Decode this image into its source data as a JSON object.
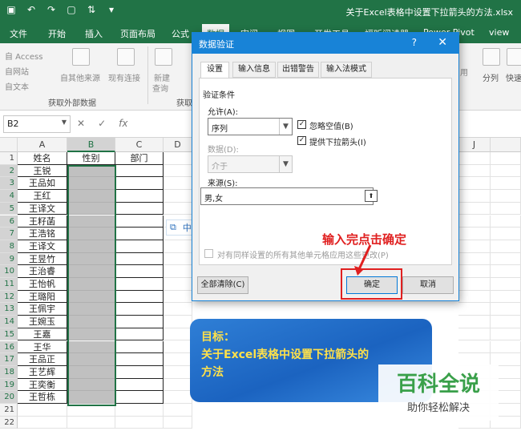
{
  "window": {
    "qat_icons": [
      "save-icon",
      "undo-icon",
      "redo-icon",
      "quick-access-icon",
      "sort-icon",
      "customize-icon"
    ],
    "doc_title": "关于Excel表格中设置下拉箭头的方法.xlsx"
  },
  "ribbon_tabs": [
    "文件",
    "开始",
    "插入",
    "页面布局",
    "公式",
    "数据",
    "审阅",
    "视图",
    "开发工具",
    "福昕阅读器",
    "Power Pivot",
    "view"
  ],
  "ribbon": {
    "access": "自 Access",
    "web": "自网站",
    "text": "自文本",
    "other_sources": "自其他来源",
    "existing": "现有连接",
    "new_query_1": "新建",
    "new_query_2": "查询",
    "get_external_group": "获取外部数据",
    "get_group_partial": "获取",
    "apply_partial": "用",
    "split": "分列",
    "quick": "快速"
  },
  "formula_bar": {
    "name_box": "B2",
    "cancel": "✕",
    "confirm": "✓",
    "fx": "fx"
  },
  "sheet": {
    "columns": [
      "A",
      "B",
      "C",
      "D",
      "J"
    ],
    "headers": [
      "姓名",
      "性别",
      "部门"
    ],
    "names": [
      "王锐",
      "王品如",
      "王红",
      "王译文",
      "王籽菡",
      "王浩铭",
      "王译文",
      "王昱竹",
      "王治睿",
      "王怡帆",
      "王璐阳",
      "王佩宇",
      "王婉玉",
      "王嘉",
      "王华",
      "王品正",
      "王艺辉",
      "王奕衡",
      "王哲栋"
    ],
    "row_numbers": [
      "1",
      "2",
      "3",
      "4",
      "5",
      "6",
      "7",
      "8",
      "9",
      "10",
      "11",
      "12",
      "13",
      "14",
      "15",
      "16",
      "17",
      "18",
      "19",
      "20",
      "21",
      "22"
    ]
  },
  "ime_toolbar": {
    "lang": "中"
  },
  "dialog": {
    "title": "数据验证",
    "help": "?",
    "close": "✕",
    "tabs": [
      "设置",
      "输入信息",
      "出错警告",
      "输入法模式"
    ],
    "criteria_label": "验证条件",
    "allow_label": "允许(A):",
    "allow_value": "序列",
    "ignore_blank": "忽略空值(B)",
    "in_cell_dropdown": "提供下拉箭头(I)",
    "data_label": "数据(D):",
    "data_value": "介于",
    "source_label": "来源(S):",
    "source_value": "男,女",
    "apply_all": "对有同样设置的所有其他单元格应用这些更改(P)",
    "clear_all": "全部清除(C)",
    "ok": "确定",
    "cancel": "取消"
  },
  "annotation": "输入完点击确定",
  "goal": {
    "line1": "目标：",
    "line2": "关于Excel表格中设置下拉箭头的",
    "line3": "方法"
  },
  "watermark": {
    "title": "百科全说",
    "subtitle": "助你轻松解决"
  },
  "colors": {
    "excel_green": "#217346",
    "dialog_blue": "#1883d7",
    "annotation_red": "#e02020",
    "watermark_green": "#3aa04a"
  }
}
